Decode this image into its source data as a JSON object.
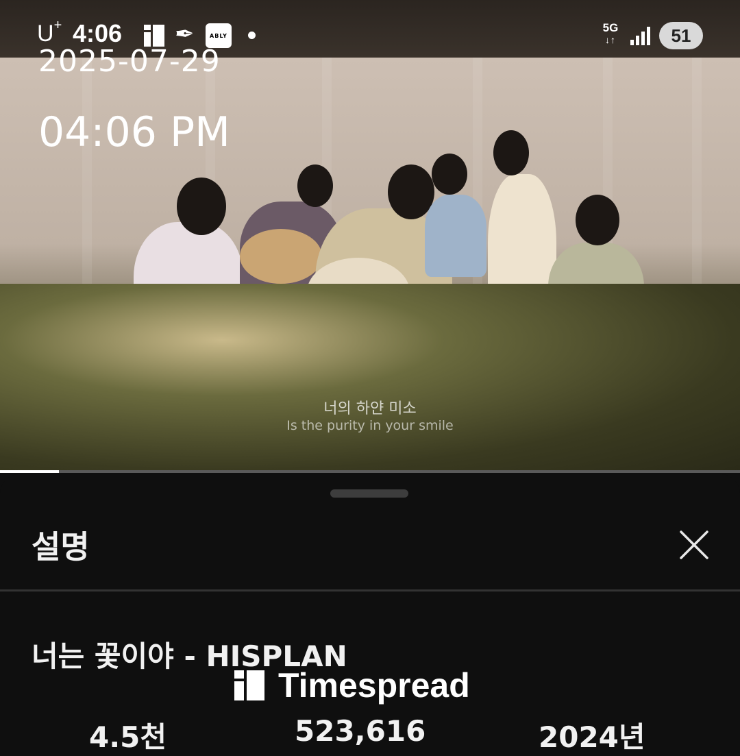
{
  "status_bar": {
    "carrier": "U",
    "carrier_sup": "+",
    "time": "4:06",
    "network": "5G",
    "battery": "51",
    "app_badge": "ABLY"
  },
  "timestamp_overlay": {
    "date": "2025-07-29",
    "time": "04:06 PM"
  },
  "video": {
    "subtitle_ko": "너의 하얀 미소",
    "subtitle_en": "Is the purity in your smile",
    "progress_fraction": 0.08,
    "icons": [
      "timespread-icon",
      "quill-icon",
      "ably-icon",
      "signal-icon",
      "battery-icon"
    ]
  },
  "description_sheet": {
    "title": "설명",
    "video_title": "너는 꽃이야 - HISPLAN",
    "stats": {
      "likes": "4.5천",
      "views": "523,616",
      "year": "2024년"
    }
  },
  "watermark": {
    "text": "Timespread"
  },
  "colors": {
    "background": "#0f0f0f",
    "text": "#f1f1f1",
    "divider": "#333333"
  }
}
